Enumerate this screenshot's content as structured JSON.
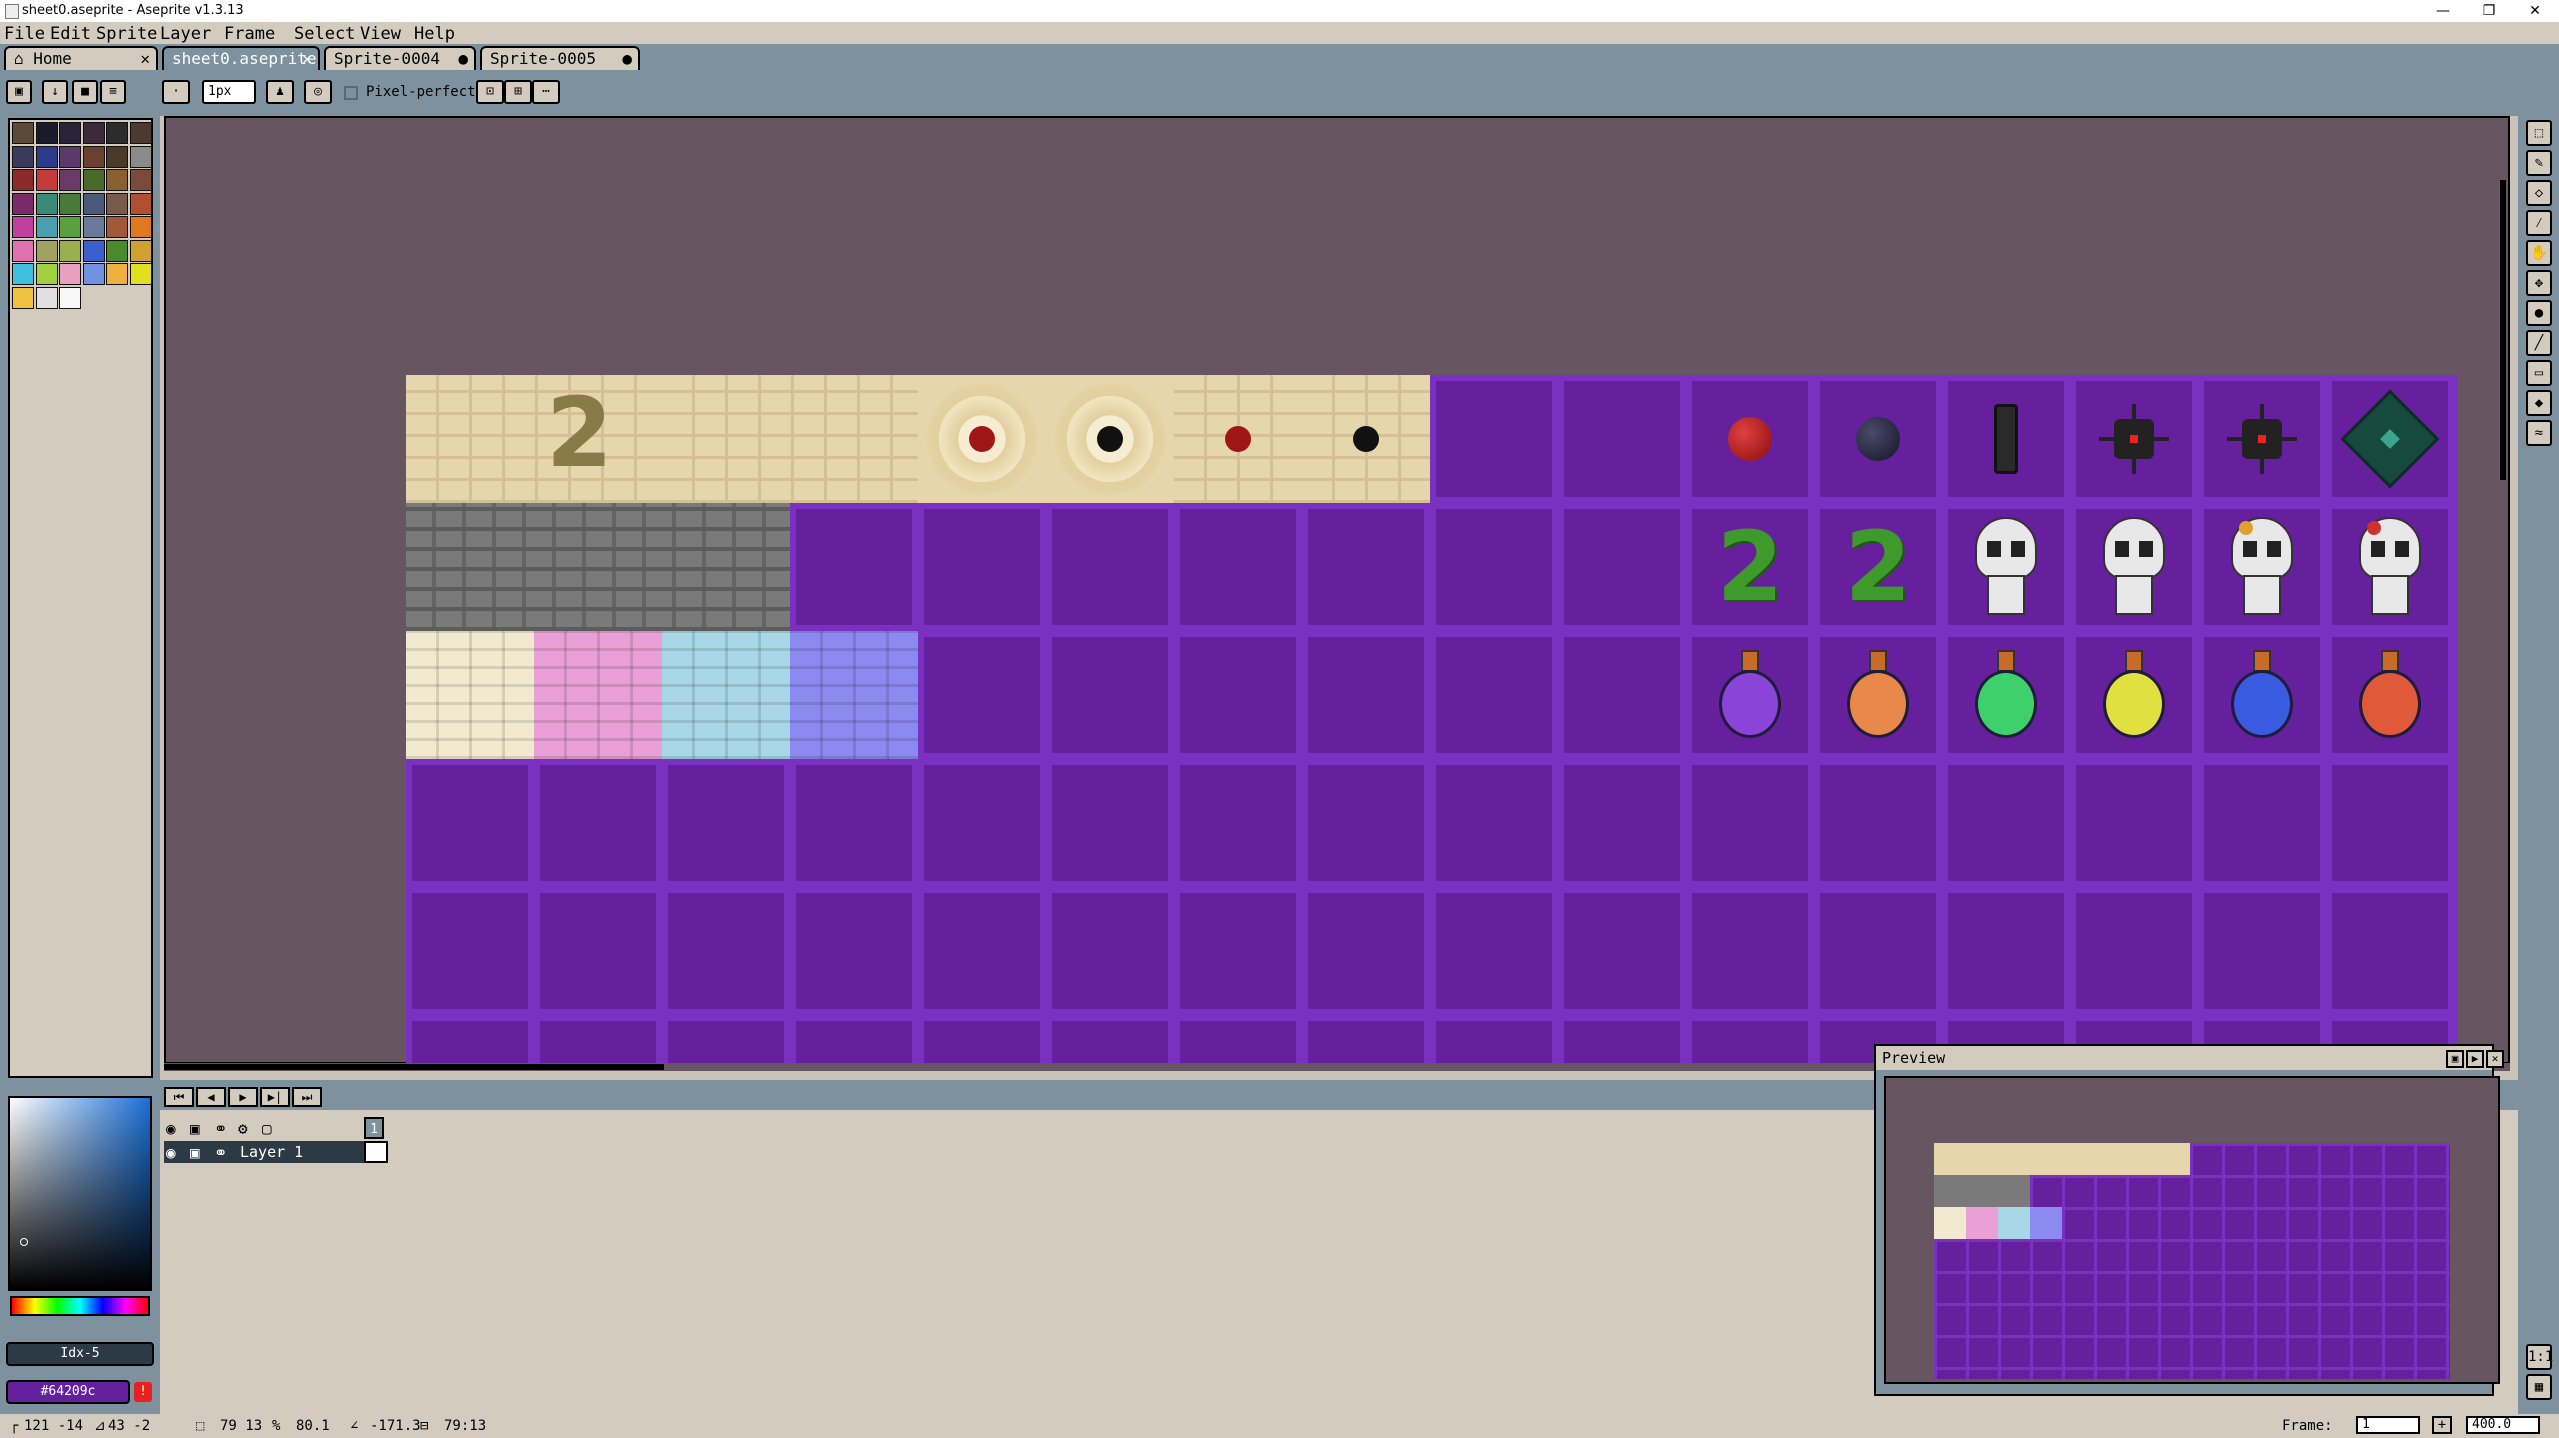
{
  "window": {
    "title": "sheet0.aseprite - Aseprite v1.3.13",
    "min": "—",
    "max": "❐",
    "close": "✕"
  },
  "menu": [
    "File",
    "Edit",
    "Sprite",
    "Layer",
    "Frame",
    "Select",
    "View",
    "Help"
  ],
  "tabs": [
    {
      "label": "Home",
      "icon": "home-icon",
      "close": "✕"
    },
    {
      "label": "sheet0.aseprite",
      "close": "✕",
      "active": true
    },
    {
      "label": "Sprite-0004",
      "close": "●"
    },
    {
      "label": "Sprite-0005",
      "close": "●"
    }
  ],
  "context": {
    "brush_size": "1px",
    "pixel_perfect": "Pixel-perfect"
  },
  "palette_colors": [
    "#5b4a3a",
    "#1a1a2a",
    "#2a2238",
    "#3a2a3a",
    "#2c2c2c",
    "#4a3a30",
    "#3a3a5c",
    "#2b3c8a",
    "#5a3a6a",
    "#6a4030",
    "#4a3a2a",
    "#8a8a8a",
    "#8a2a2a",
    "#c23a3a",
    "#6a3a6a",
    "#4a6a2a",
    "#8a6030",
    "#7a4a3a",
    "#7a2a6a",
    "#3a8a7a",
    "#4a7a3a",
    "#4a5a7a",
    "#7a5a4a",
    "#b05030",
    "#c040a0",
    "#4aa0b0",
    "#5aa040",
    "#6a7a9a",
    "#a05a3a",
    "#e07a20",
    "#e070b0",
    "#a0a060",
    "#9ab050",
    "#3a60d0",
    "#4a8a2a",
    "#d0a030",
    "#40c0e0",
    "#a0d040",
    "#e8a0c0",
    "#7090e0",
    "#f0b040",
    "#e0e020",
    "#f0c040",
    "#e0e0e0",
    "#f8f8f8"
  ],
  "color": {
    "index": "Idx-5",
    "hex": "#64209c",
    "fg": "#64209c"
  },
  "timeline": {
    "buttons": [
      "⏮",
      "◀",
      "▶",
      "▶|",
      "⏭"
    ],
    "frame_number": "1",
    "layer_name": "Layer 1"
  },
  "preview": {
    "title": "Preview"
  },
  "status": {
    "pos": "121 -14",
    "size": "43 -2",
    "sel": "79 13",
    "pct": "80.1",
    "angle": "-171.3",
    "ratio": "79:13",
    "frame_label": "Frame:",
    "frame_value": "1",
    "zoom": "400.0"
  },
  "sprite_tiles": {
    "orb_colors": [
      "#b71c1c",
      "#1e1b3a"
    ],
    "potion_colors": [
      "#8a45d8",
      "#e8884a",
      "#3ed06a",
      "#e0e040",
      "#3a5ae0",
      "#e05a3a"
    ],
    "brick_colors": [
      "#f2ead0",
      "#e8a0d6",
      "#a8d8e8",
      "#8a8af0"
    ]
  }
}
